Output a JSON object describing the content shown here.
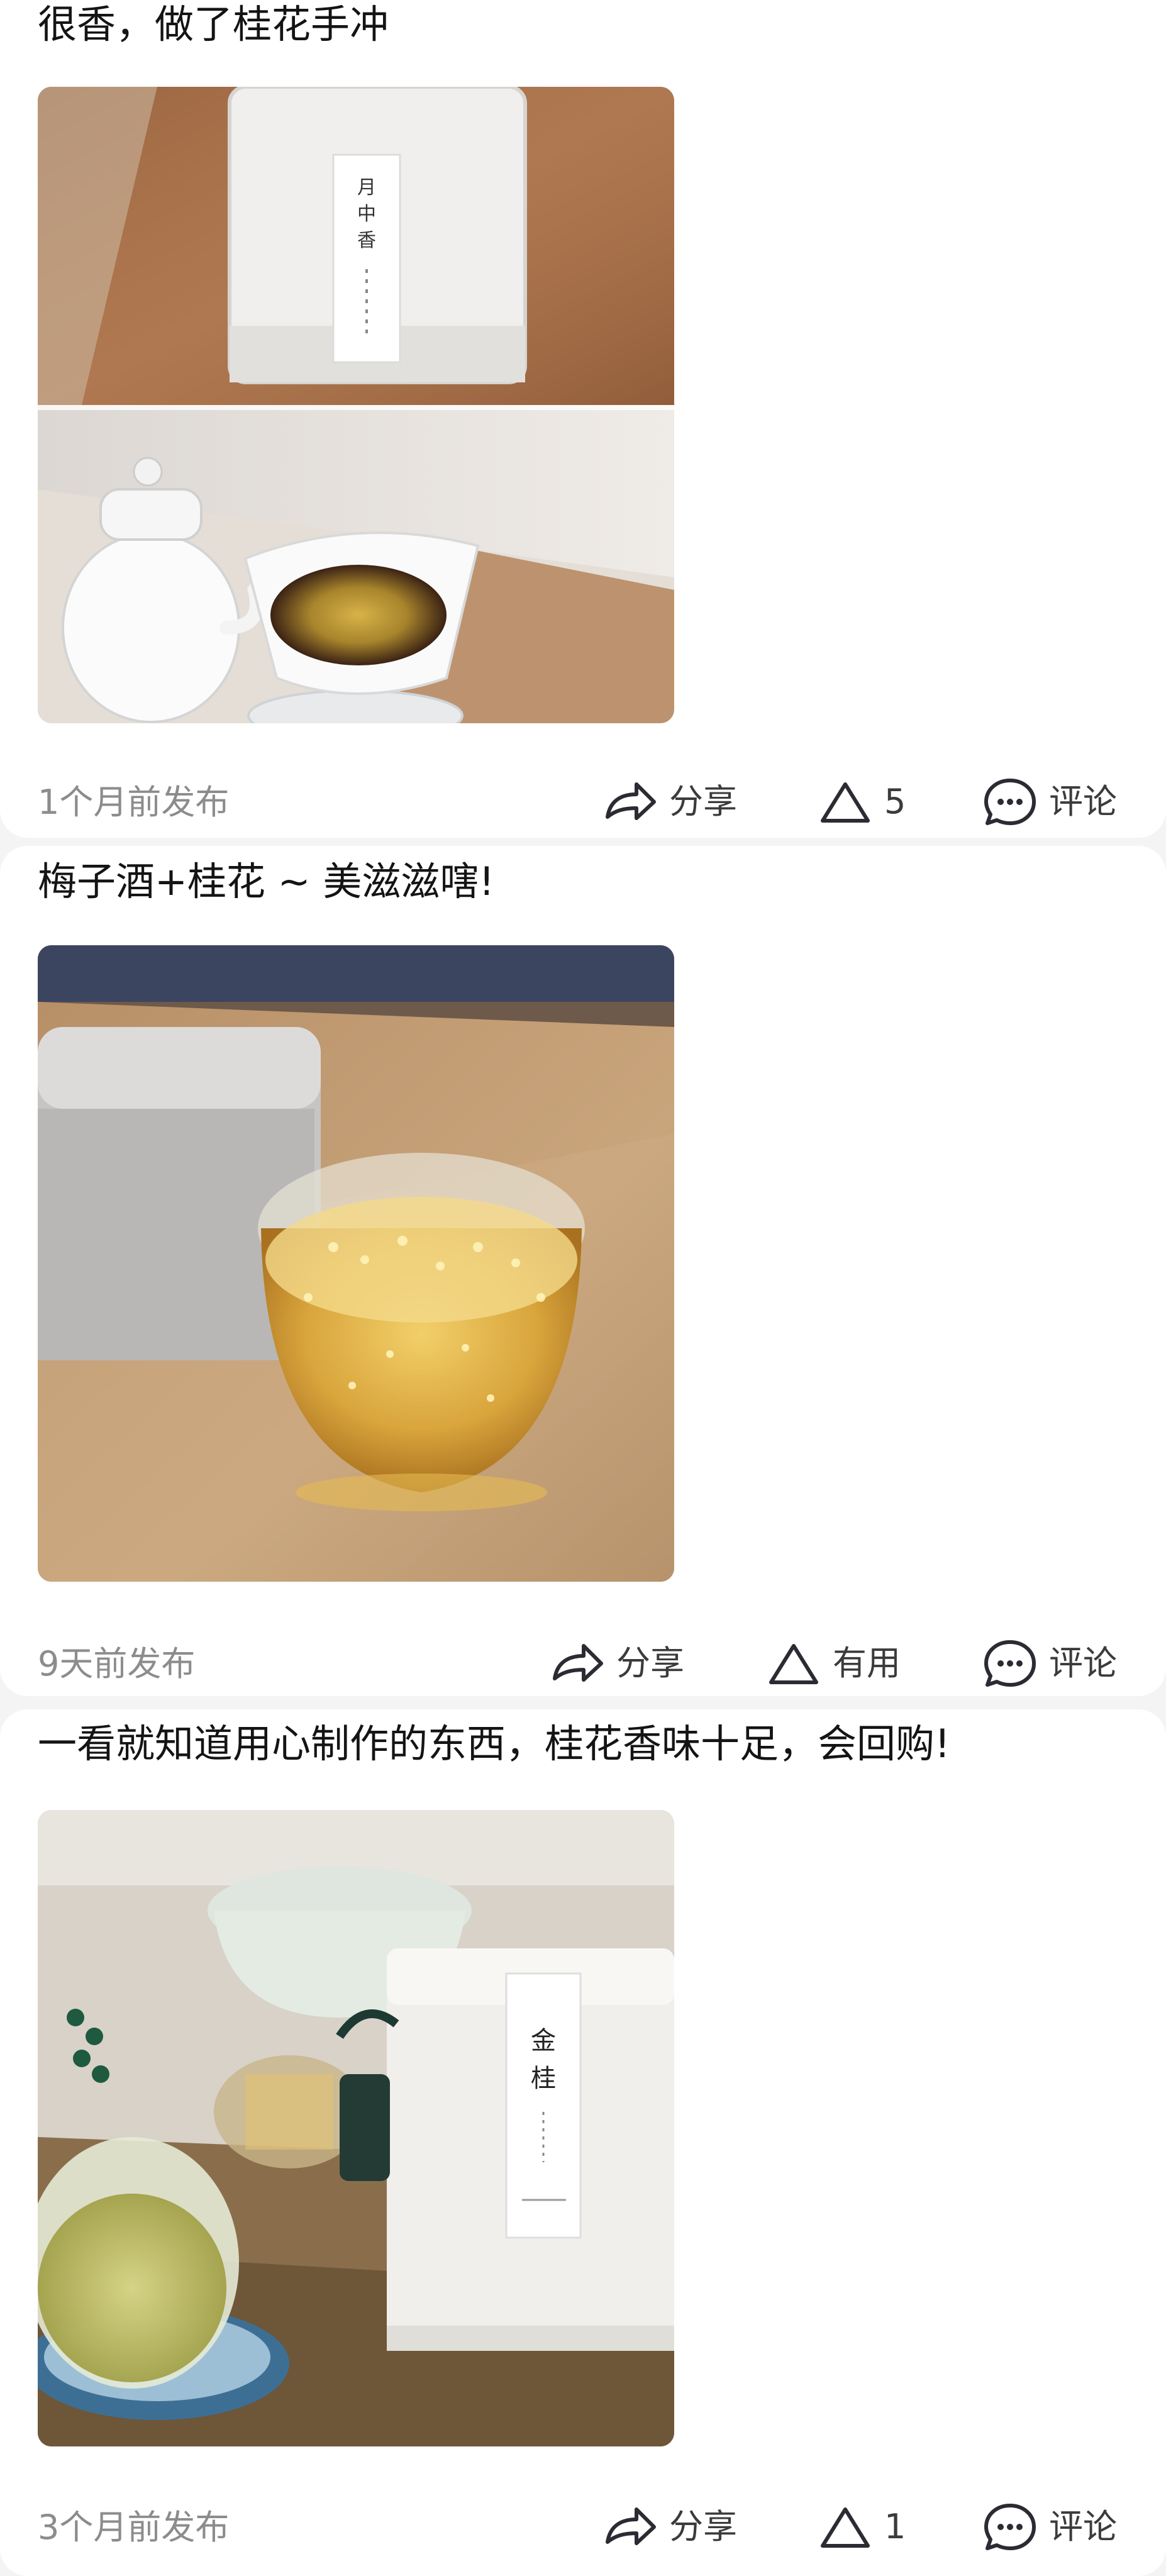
{
  "posts": [
    {
      "text": "很香，做了桂花手冲",
      "time": "1个月前发布",
      "share_label": "分享",
      "like_label": "5",
      "comment_label": "评论",
      "image_alt": "月中香 金桂 tin and pour-over coffee with osmanthus",
      "tin_label_text": "月 中 香"
    },
    {
      "text": "梅子酒+桂花 ~ 美滋滋嗐!",
      "time": "9天前发布",
      "share_label": "分享",
      "like_label": "有用",
      "comment_label": "评论",
      "image_alt": "grey tin and glass of plum wine with osmanthus"
    },
    {
      "text": "一看就知道用心制作的东西，桂花香味十足，会回购!",
      "time": "3个月前发布",
      "share_label": "分享",
      "like_label": "1",
      "comment_label": "评论",
      "image_alt": "glass teapot with osmanthus tea beside a white 金桂 tin",
      "tin_label_text": "金 桂"
    }
  ],
  "icons": {
    "share": "share-arrow-icon",
    "like": "triangle-useful-icon",
    "comment": "comment-bubble-icon"
  },
  "colors": {
    "text": "#141414",
    "meta": "#8c8c8c",
    "icon": "#2b2b33",
    "card": "#ffffff",
    "divider": "#f4f4f4"
  }
}
